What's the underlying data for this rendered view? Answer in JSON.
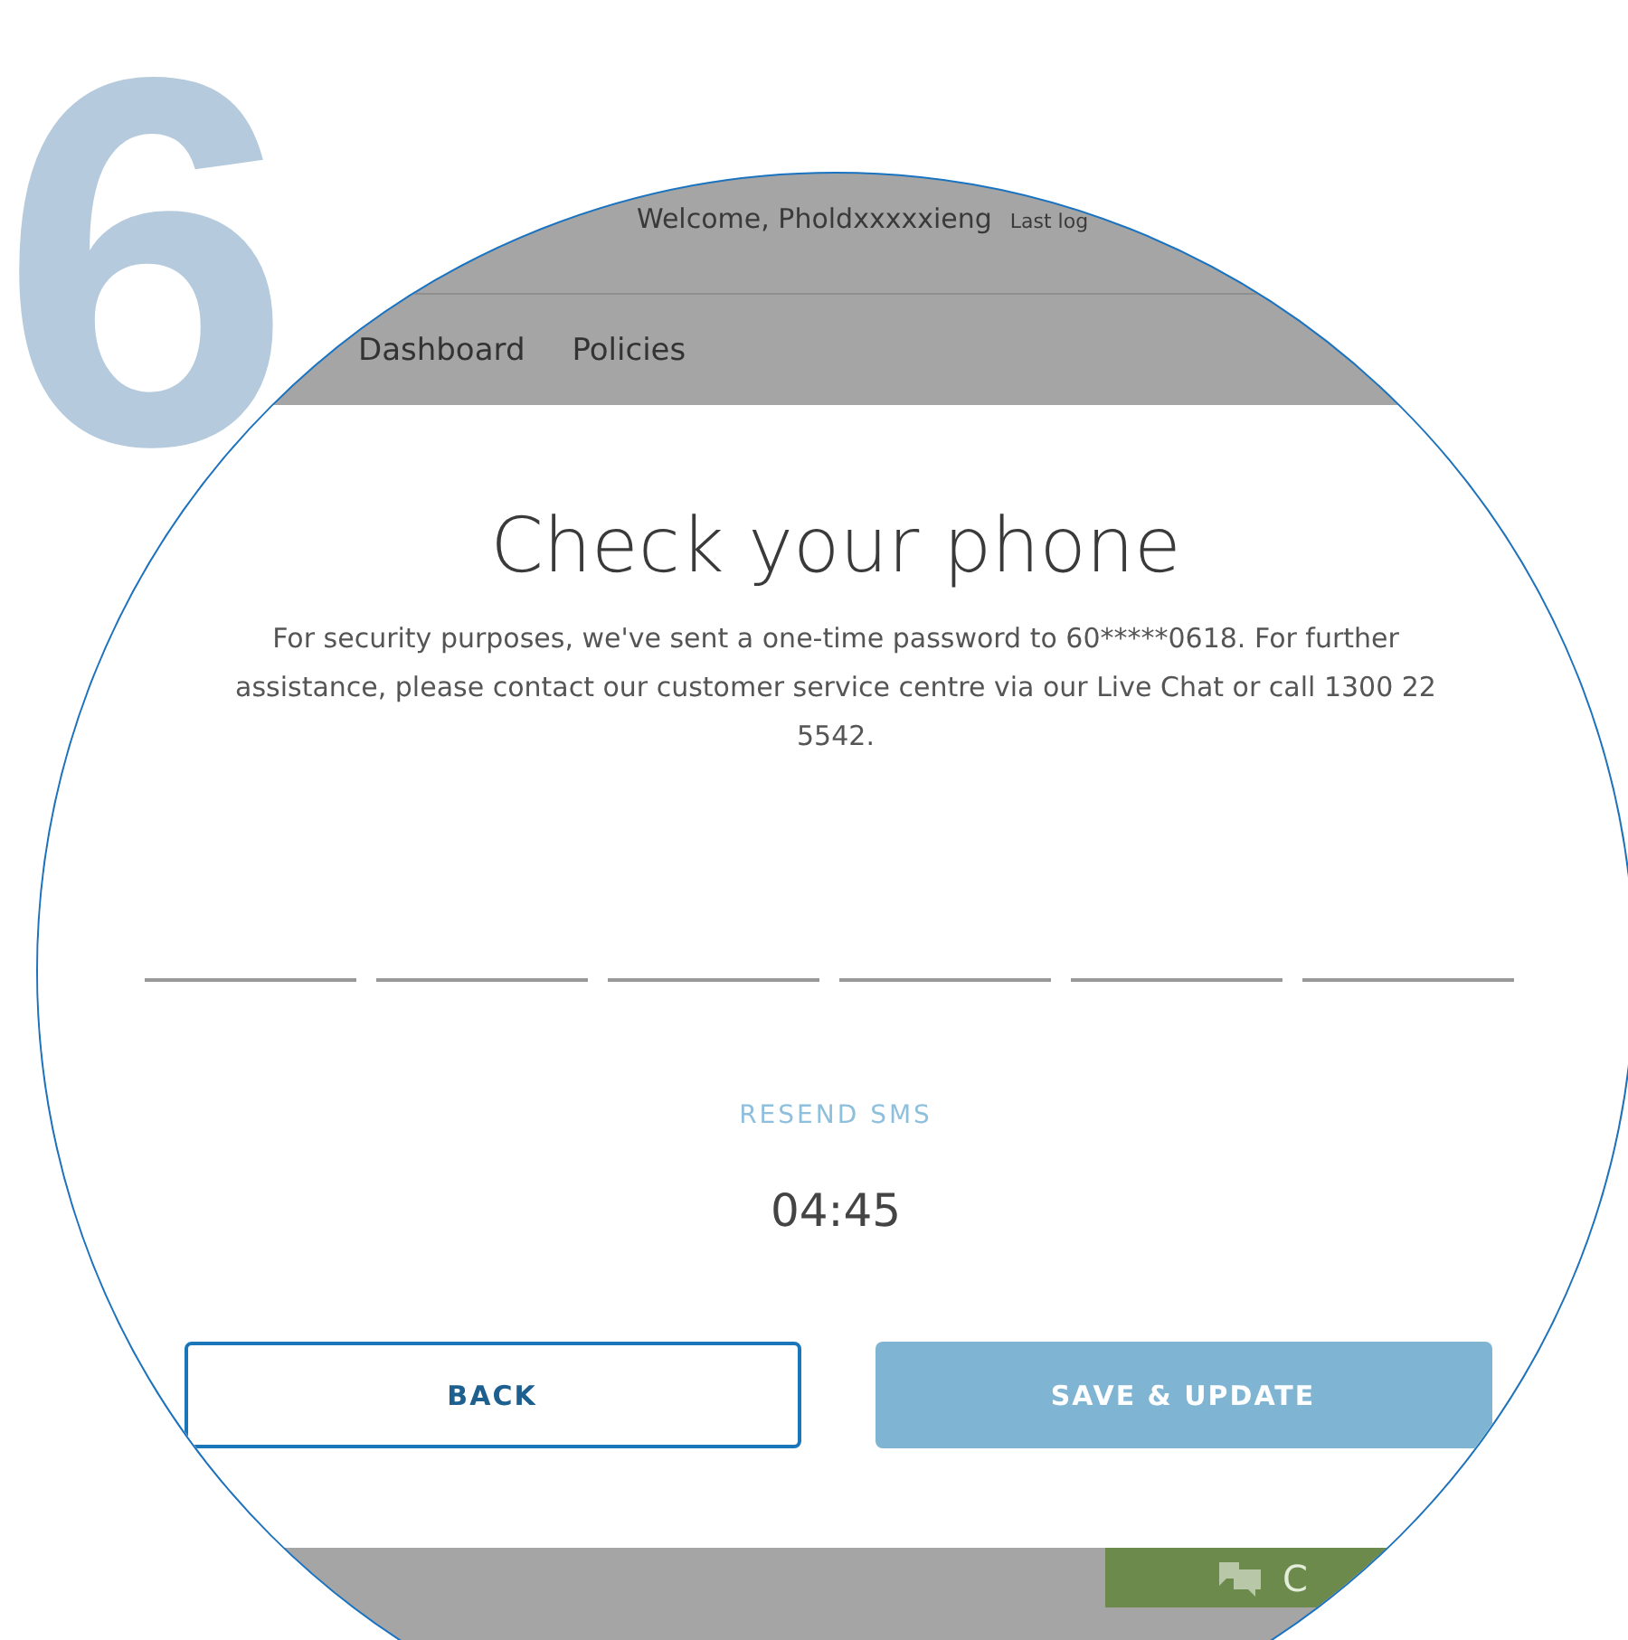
{
  "step": "6",
  "header": {
    "welcome": "Welcome, Pholdxxxxxieng",
    "last_login": "Last log"
  },
  "nav": [
    {
      "label": "Dashboard"
    },
    {
      "label": "Policies"
    }
  ],
  "dialog": {
    "title": "Check your phone",
    "message": "For security purposes, we've sent a one-time password to 60*****0618. For further assistance, please contact our customer service centre via our Live Chat or call 1300 22 5542.",
    "otp_fields": [
      {
        "kind": "digit"
      },
      {
        "kind": "digit"
      },
      {
        "kind": "digit"
      },
      {
        "kind": "digit"
      },
      {
        "kind": "digit"
      },
      {
        "kind": "digit"
      }
    ],
    "resend": "RESEND SMS",
    "timer": "04:45",
    "buttons": [
      {
        "label": "BACK",
        "disabled": false
      },
      {
        "label": "SAVE & UPDATE",
        "disabled": true
      }
    ]
  },
  "chat_button": {
    "label": "C"
  }
}
